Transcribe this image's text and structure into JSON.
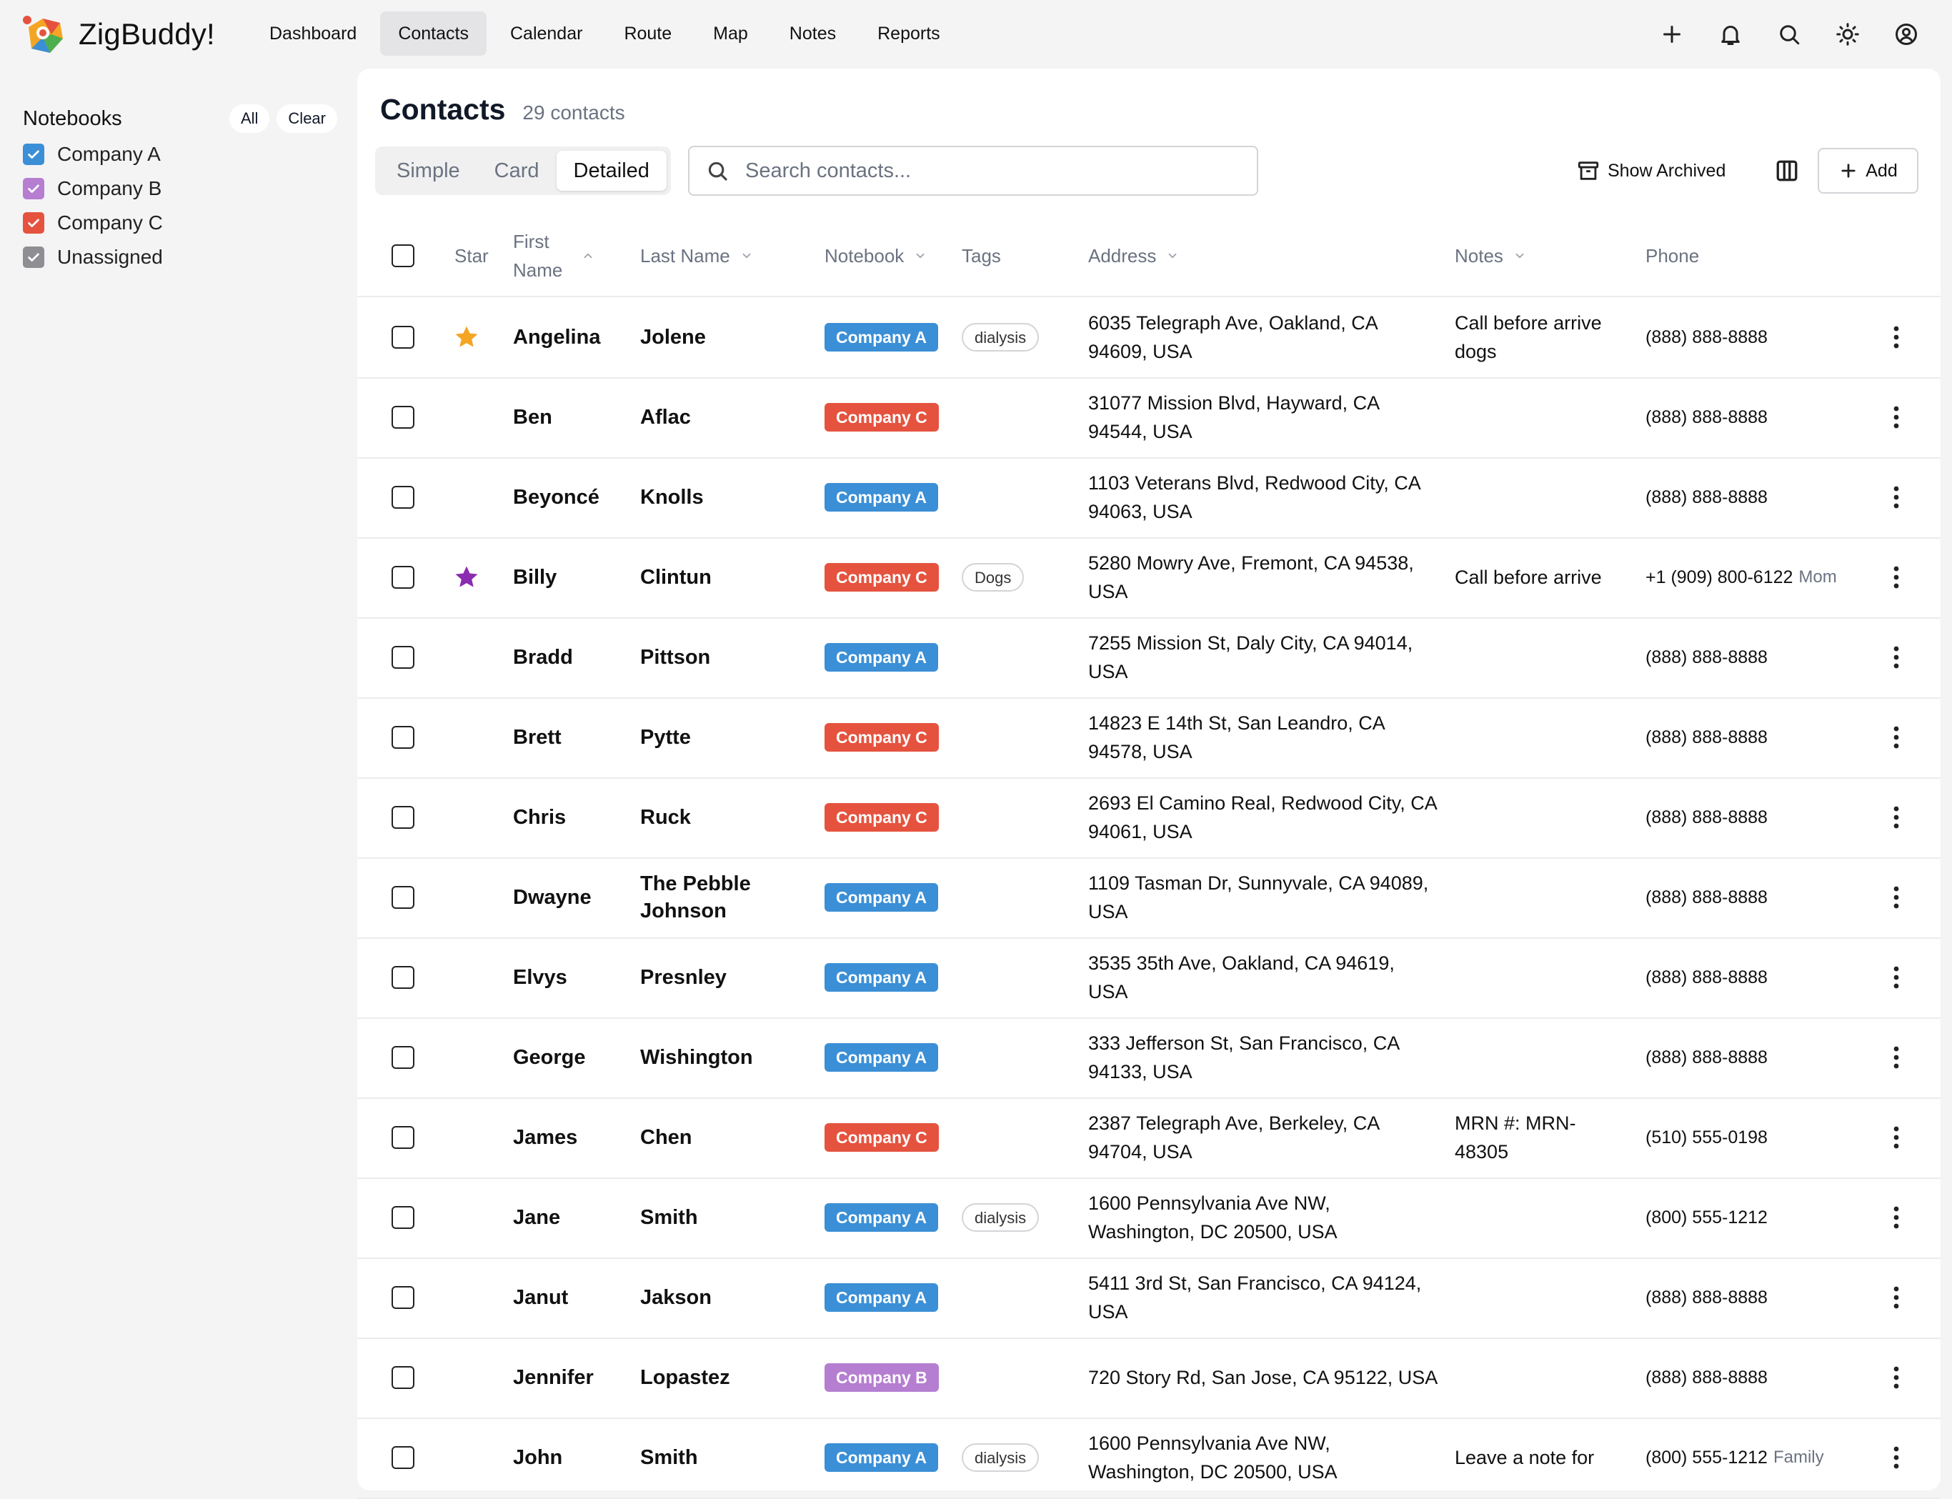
{
  "app": {
    "name": "ZigBuddy!"
  },
  "nav": [
    {
      "label": "Dashboard",
      "active": false
    },
    {
      "label": "Contacts",
      "active": true
    },
    {
      "label": "Calendar",
      "active": false
    },
    {
      "label": "Route",
      "active": false
    },
    {
      "label": "Map",
      "active": false
    },
    {
      "label": "Notes",
      "active": false
    },
    {
      "label": "Reports",
      "active": false
    }
  ],
  "top_actions": [
    "plus-icon",
    "bell-icon",
    "search-icon",
    "sun-icon",
    "user-circle-icon"
  ],
  "sidebar": {
    "title": "Notebooks",
    "all_label": "All",
    "clear_label": "Clear",
    "notebooks": [
      {
        "label": "Company A",
        "color": "#3b8fd6",
        "checked": true
      },
      {
        "label": "Company B",
        "color": "#b57ed1",
        "checked": true
      },
      {
        "label": "Company C",
        "color": "#e5533f",
        "checked": true
      },
      {
        "label": "Unassigned",
        "color": "#8e8e93",
        "checked": true
      }
    ]
  },
  "page": {
    "title": "Contacts",
    "count": "29 contacts",
    "views": [
      "Simple",
      "Card",
      "Detailed"
    ],
    "active_view": "Detailed",
    "search_placeholder": "Search contacts...",
    "show_archived": "Show Archived",
    "add_label": "Add"
  },
  "columns": {
    "star": "Star",
    "first_name": "First Name",
    "last_name": "Last Name",
    "notebook": "Notebook",
    "tags": "Tags",
    "address": "Address",
    "notes": "Notes",
    "phone": "Phone"
  },
  "colors": {
    "Company A": "#3b8fd6",
    "Company B": "#b57ed1",
    "Company C": "#e5533f",
    "star_orange": "#f5a524",
    "star_purple": "#8b2bb0"
  },
  "contacts": [
    {
      "first": "Angelina",
      "last": "Jolene",
      "notebook": "Company A",
      "tag": "dialysis",
      "address": "6035 Telegraph Ave, Oakland, CA 94609, USA",
      "notes": "Call before arrive dogs",
      "phone": "(888) 888-8888",
      "phone_label": "",
      "star": "orange"
    },
    {
      "first": "Ben",
      "last": "Aflac",
      "notebook": "Company C",
      "tag": "",
      "address": "31077 Mission Blvd, Hayward, CA 94544, USA",
      "notes": "",
      "phone": "(888) 888-8888",
      "phone_label": "",
      "star": ""
    },
    {
      "first": "Beyoncé",
      "last": "Knolls",
      "notebook": "Company A",
      "tag": "",
      "address": "1103 Veterans Blvd, Redwood City, CA 94063, USA",
      "notes": "",
      "phone": "(888) 888-8888",
      "phone_label": "",
      "star": ""
    },
    {
      "first": "Billy",
      "last": "Clintun",
      "notebook": "Company C",
      "tag": "Dogs",
      "address": "5280 Mowry Ave, Fremont, CA 94538, USA",
      "notes": "Call before arrive",
      "phone": "+1 (909) 800-6122",
      "phone_label": "Mom",
      "star": "purple"
    },
    {
      "first": "Bradd",
      "last": "Pittson",
      "notebook": "Company A",
      "tag": "",
      "address": "7255 Mission St, Daly City, CA 94014, USA",
      "notes": "",
      "phone": "(888) 888-8888",
      "phone_label": "",
      "star": ""
    },
    {
      "first": "Brett",
      "last": "Pytte",
      "notebook": "Company C",
      "tag": "",
      "address": "14823 E 14th St, San Leandro, CA 94578, USA",
      "notes": "",
      "phone": "(888) 888-8888",
      "phone_label": "",
      "star": ""
    },
    {
      "first": "Chris",
      "last": "Ruck",
      "notebook": "Company C",
      "tag": "",
      "address": "2693 El Camino Real, Redwood City, CA 94061, USA",
      "notes": "",
      "phone": "(888) 888-8888",
      "phone_label": "",
      "star": ""
    },
    {
      "first": "Dwayne",
      "last": "The Pebble Johnson",
      "notebook": "Company A",
      "tag": "",
      "address": "1109 Tasman Dr, Sunnyvale, CA 94089, USA",
      "notes": "",
      "phone": "(888) 888-8888",
      "phone_label": "",
      "star": ""
    },
    {
      "first": "Elvys",
      "last": "Presnley",
      "notebook": "Company A",
      "tag": "",
      "address": "3535 35th Ave, Oakland, CA 94619, USA",
      "notes": "",
      "phone": "(888) 888-8888",
      "phone_label": "",
      "star": ""
    },
    {
      "first": "George",
      "last": "Wishington",
      "notebook": "Company A",
      "tag": "",
      "address": "333 Jefferson St, San Francisco, CA 94133, USA",
      "notes": "",
      "phone": "(888) 888-8888",
      "phone_label": "",
      "star": ""
    },
    {
      "first": "James",
      "last": "Chen",
      "notebook": "Company C",
      "tag": "",
      "address": "2387 Telegraph Ave, Berkeley, CA 94704, USA",
      "notes": "MRN #: MRN-48305",
      "phone": "(510) 555-0198",
      "phone_label": "",
      "star": ""
    },
    {
      "first": "Jane",
      "last": "Smith",
      "notebook": "Company A",
      "tag": "dialysis",
      "address": "1600 Pennsylvania Ave NW, Washington, DC 20500, USA",
      "notes": "",
      "phone": "(800) 555-1212",
      "phone_label": "",
      "star": ""
    },
    {
      "first": "Janut",
      "last": "Jakson",
      "notebook": "Company A",
      "tag": "",
      "address": "5411 3rd St, San Francisco, CA 94124, USA",
      "notes": "",
      "phone": "(888) 888-8888",
      "phone_label": "",
      "star": ""
    },
    {
      "first": "Jennifer",
      "last": "Lopastez",
      "notebook": "Company B",
      "tag": "",
      "address": "720 Story Rd, San Jose, CA 95122, USA",
      "notes": "",
      "phone": "(888) 888-8888",
      "phone_label": "",
      "star": ""
    },
    {
      "first": "John",
      "last": "Smith",
      "notebook": "Company A",
      "tag": "dialysis",
      "address": "1600 Pennsylvania Ave NW, Washington, DC 20500, USA",
      "notes": "Leave a note for",
      "phone": "(800) 555-1212",
      "phone_label": "Family",
      "star": ""
    }
  ]
}
